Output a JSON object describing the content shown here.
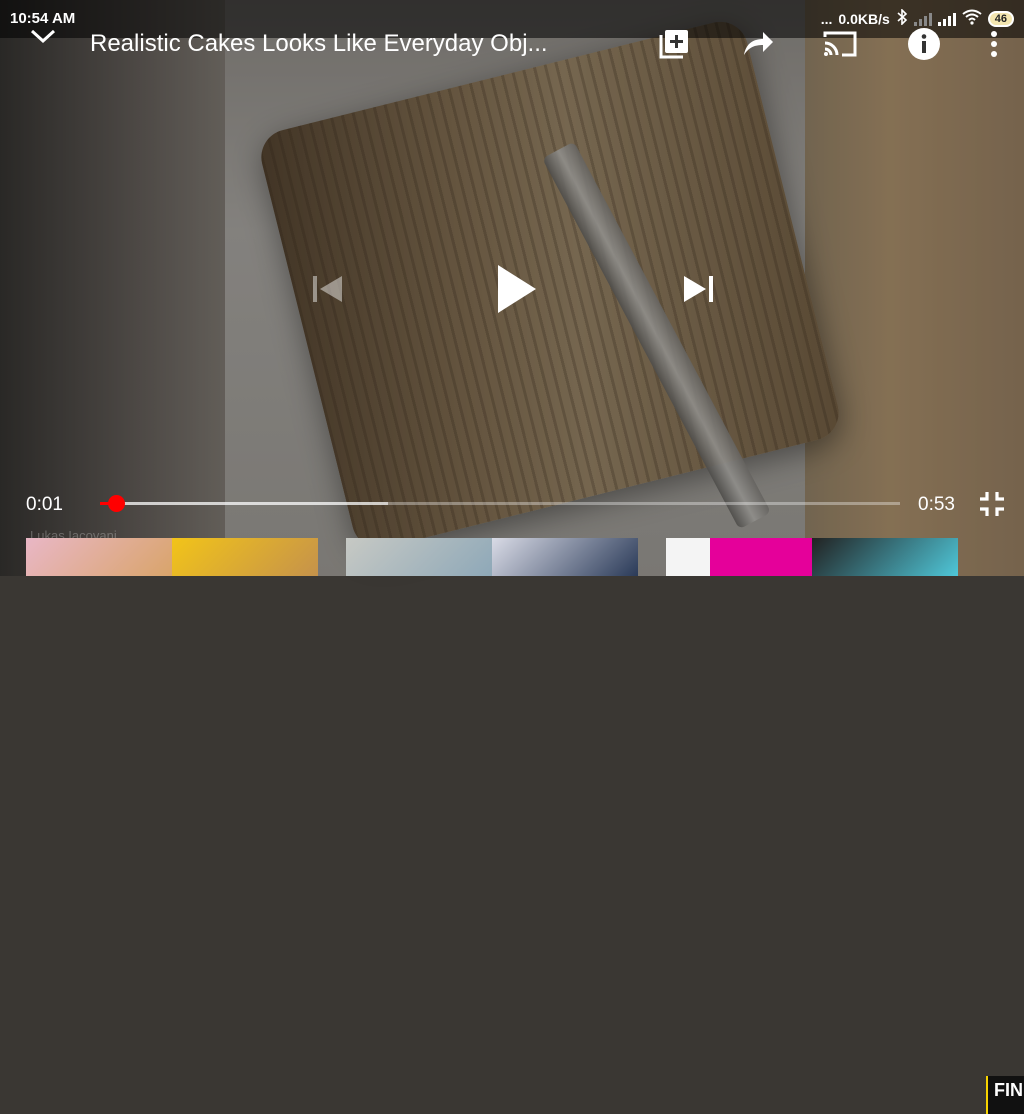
{
  "status_bar": {
    "time": "10:54 AM",
    "dots": "...",
    "net_speed": "0.0KB/s",
    "battery": "46"
  },
  "player": {
    "title": "Realistic Cakes Looks Like Everyday Obj...",
    "current_time": "0:01",
    "duration": "0:53",
    "progress_fraction": 0.02,
    "buffer_fraction": 0.36,
    "watermark": "Lukas Iacovani"
  },
  "thumbnails": {
    "last_label": "FIN"
  },
  "colors": {
    "accent": "#ff0000",
    "overlay": "#000000"
  },
  "icons": [
    "chevron-down-icon",
    "add-to-playlist-icon",
    "share-icon",
    "cast-icon",
    "info-icon",
    "more-vert-icon",
    "previous-icon",
    "play-icon",
    "next-icon",
    "fullscreen-exit-icon",
    "bluetooth-icon",
    "signal-icon",
    "wifi-icon",
    "battery-icon"
  ]
}
